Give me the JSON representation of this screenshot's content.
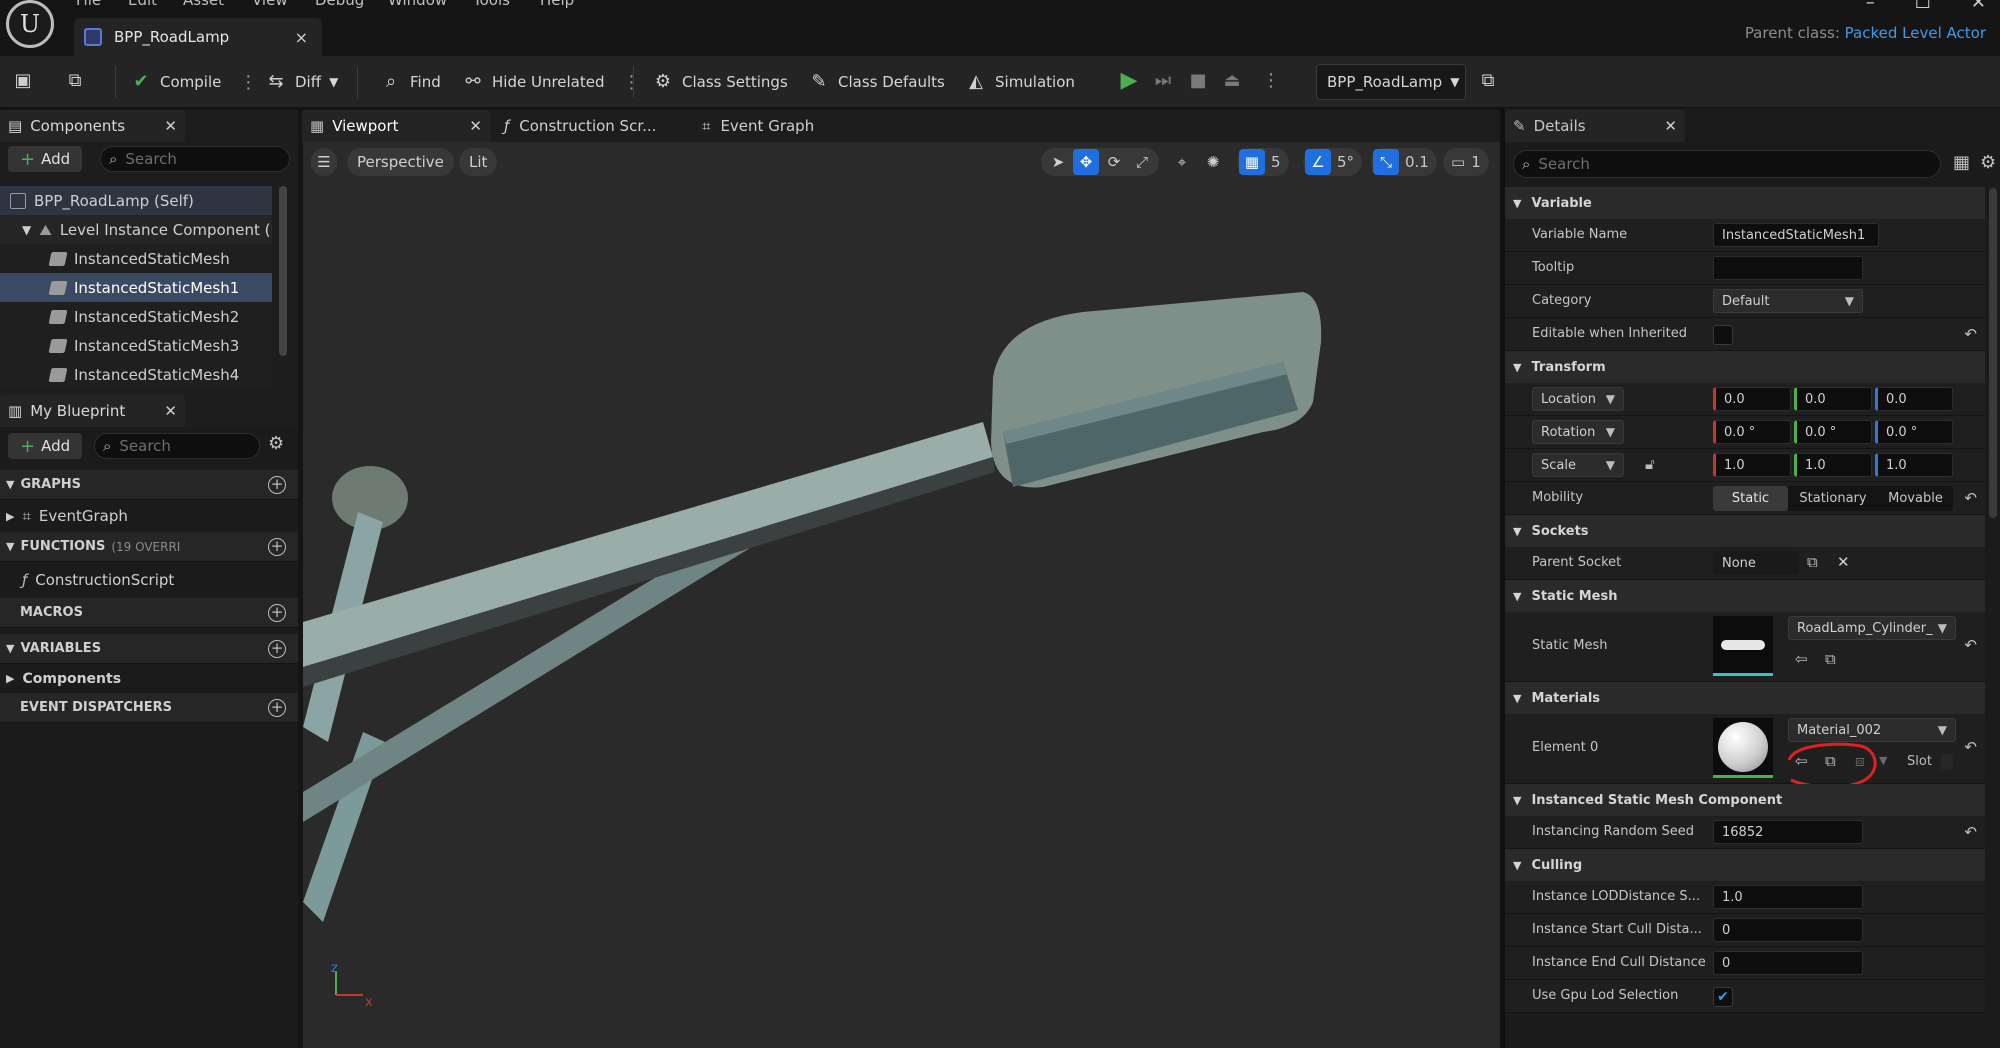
{
  "menu": [
    "File",
    "Edit",
    "Asset",
    "View",
    "Debug",
    "Window",
    "Tools",
    "Help"
  ],
  "doc_tab": {
    "title": "BPP_RoadLamp",
    "close": "×"
  },
  "window_buttons": {
    "minimize": "–",
    "maximize": "☐",
    "close": "✕"
  },
  "parent_class": {
    "label": "Parent class:",
    "value": "Packed Level Actor"
  },
  "toolbar": {
    "compile": "Compile",
    "diff": "Diff",
    "find": "Find",
    "hide_unrelated": "Hide Unrelated",
    "class_settings": "Class Settings",
    "class_defaults": "Class Defaults",
    "simulation": "Simulation",
    "blueprint_select": "BPP_RoadLamp"
  },
  "components_panel": {
    "title": "Components",
    "add": "Add",
    "search_placeholder": "Search",
    "items": [
      {
        "label": "BPP_RoadLamp (Self)"
      },
      {
        "label": "Level Instance Component (Ro"
      },
      {
        "label": "InstancedStaticMesh"
      },
      {
        "label": "InstancedStaticMesh1"
      },
      {
        "label": "InstancedStaticMesh2"
      },
      {
        "label": "InstancedStaticMesh3"
      },
      {
        "label": "InstancedStaticMesh4"
      }
    ]
  },
  "my_blueprint": {
    "title": "My Blueprint",
    "add": "Add",
    "search_placeholder": "Search",
    "graphs": "GRAPHS",
    "event_graph": "EventGraph",
    "functions": "FUNCTIONS",
    "functions_count": "(19 OVERRI",
    "construction_script": "ConstructionScript",
    "macros": "MACROS",
    "variables": "VARIABLES",
    "components": "Components",
    "event_dispatchers": "EVENT DISPATCHERS"
  },
  "center_tabs": [
    "Viewport",
    "Construction Scr...",
    "Event Graph"
  ],
  "viewport": {
    "perspective": "Perspective",
    "lit": "Lit",
    "grid_snap": "5",
    "rot_snap": "5°",
    "scale_snap": "0.1",
    "camera_speed": "1",
    "axis_z": "z",
    "axis_x": "x"
  },
  "details": {
    "title": "Details",
    "search_placeholder": "Search",
    "variable": {
      "section": "Variable",
      "variable_name_label": "Variable Name",
      "variable_name": "InstancedStaticMesh1",
      "tooltip_label": "Tooltip",
      "tooltip": "",
      "category_label": "Category",
      "category": "Default",
      "editable_label": "Editable when Inherited"
    },
    "transform": {
      "section": "Transform",
      "location_label": "Location",
      "location": [
        "0.0",
        "0.0",
        "0.0"
      ],
      "rotation_label": "Rotation",
      "rotation": [
        "0.0 °",
        "0.0 °",
        "0.0 °"
      ],
      "scale_label": "Scale",
      "scale": [
        "1.0",
        "1.0",
        "1.0"
      ],
      "mobility_label": "Mobility",
      "mobility_options": [
        "Static",
        "Stationary",
        "Movable"
      ]
    },
    "sockets": {
      "section": "Sockets",
      "parent_socket_label": "Parent Socket",
      "parent_socket": "None"
    },
    "static_mesh": {
      "section": "Static Mesh",
      "label": "Static Mesh",
      "value": "RoadLamp_Cylinder_"
    },
    "materials": {
      "section": "Materials",
      "element_label": "Element 0",
      "value": "Material_002",
      "slot": "Slot"
    },
    "ismc": {
      "section": "Instanced Static Mesh Component",
      "seed_label": "Instancing Random Seed",
      "seed": "16852"
    },
    "culling": {
      "section": "Culling",
      "lod_label": "Instance LODDistance S...",
      "lod": "1.0",
      "start_label": "Instance Start Cull Dista...",
      "start": "0",
      "end_label": "Instance End Cull Distance",
      "end": "0",
      "gpu_label": "Use Gpu Lod Selection"
    }
  },
  "colors": {
    "accent_blue": "#3f9ae8",
    "play_green": "#4caf50",
    "selection": "#3b4a63",
    "annotation_red": "#e02020"
  }
}
